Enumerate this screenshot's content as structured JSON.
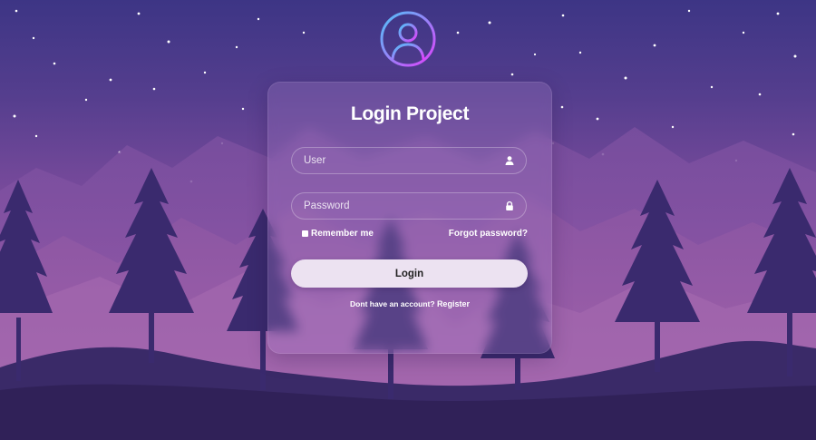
{
  "app": {
    "title": "Login Project"
  },
  "form": {
    "user_placeholder": "User",
    "user_value": "",
    "password_placeholder": "Password",
    "password_value": "",
    "remember_label": "Remember me",
    "remember_checked": false,
    "forgot_label": "Forgot password?",
    "login_label": "Login",
    "no_account_text": "Dont have an account?",
    "register_label": "Register"
  },
  "icons": {
    "avatar": "user-circle-icon",
    "user_field": "user-icon",
    "password_field": "lock-icon"
  },
  "colors": {
    "avatar_gradient_start": "#4fc3f7",
    "avatar_gradient_end": "#e040fb",
    "sky_top": "#3d3585",
    "button_bg": "#ece2f1",
    "ground": "#3a2a68"
  }
}
